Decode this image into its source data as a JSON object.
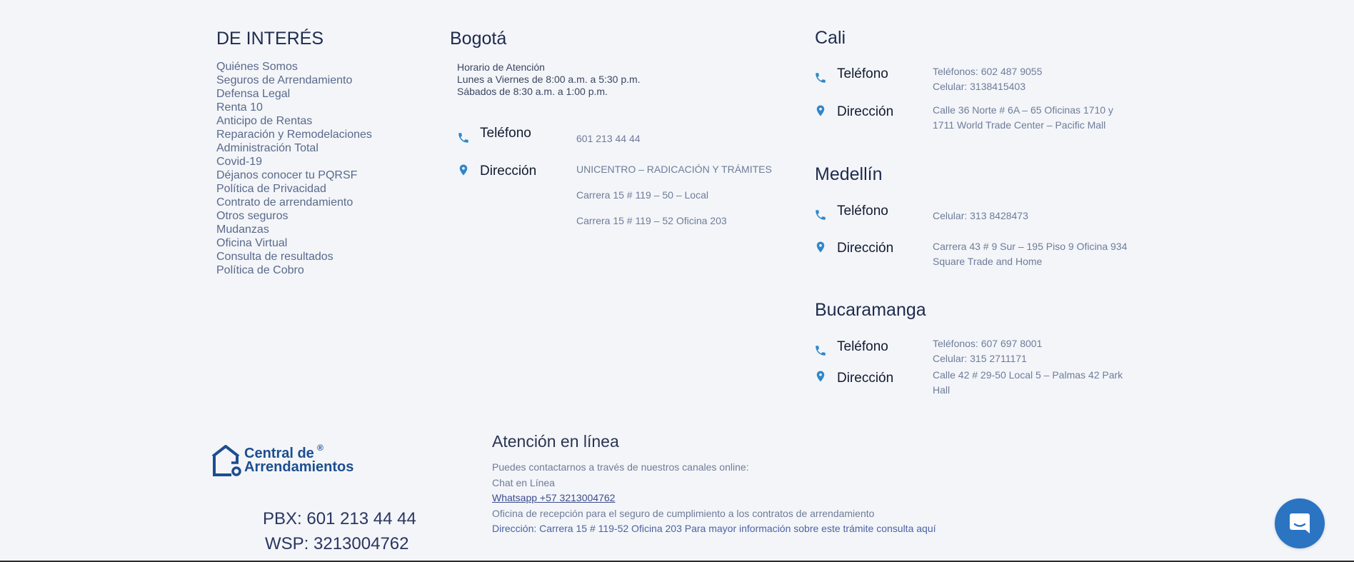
{
  "interes": {
    "title": "DE INTERÉS",
    "links": [
      "Quiénes Somos",
      "Seguros de Arrendamiento",
      "Defensa Legal",
      "Renta 10",
      "Anticipo de Rentas",
      "Reparación y Remodelaciones",
      "Administración Total",
      "Covid-19",
      "Déjanos conocer tu PQRSF",
      "Política de Privacidad",
      "Contrato de arrendamiento",
      "Otros seguros",
      "Mudanzas",
      "Oficina Virtual",
      "Consulta de resultados",
      "Política de Cobro"
    ]
  },
  "bogota": {
    "title": "Bogotá",
    "hours_title": "Horario de Atención",
    "hours_weekday": "Lunes a Viernes de 8:00 a.m. a 5:30 p.m.",
    "hours_saturday": "Sábados de 8:30 a.m. a 1:00 p.m.",
    "phone_label": "Teléfono",
    "phone_value": "601 213 44 44",
    "address_label": "Dirección",
    "address_lines": [
      "UNICENTRO – RADICACIÓN Y TRÁMITES",
      "Carrera 15 # 119 – 50 – Local",
      "Carrera 15 # 119 – 52 Oficina 203"
    ]
  },
  "cali": {
    "title": "Cali",
    "phone_label": "Teléfono",
    "phone_lines": [
      "Teléfonos: 602 487 9055",
      "Celular: 3138415403"
    ],
    "address_label": "Dirección",
    "address_lines": [
      "Calle 36 Norte # 6A – 65 Oficinas 1710 y",
      "1711 World Trade Center – Pacific Mall"
    ]
  },
  "medellin": {
    "title": "Medellín",
    "phone_label": "Teléfono",
    "phone_lines": [
      "Celular: 313 8428473"
    ],
    "address_label": "Dirección",
    "address_lines": [
      "Carrera 43 # 9 Sur – 195 Piso 9 Oficina 934",
      "Square Trade and Home"
    ]
  },
  "bucaramanga": {
    "title": "Bucaramanga",
    "phone_label": "Teléfono",
    "phone_lines": [
      "Teléfonos: 607 697 8001",
      "Celular: 315 2711171"
    ],
    "address_label": "Dirección",
    "address_lines": [
      "Calle 42 # 29-50 Local 5 – Palmas 42 Park",
      "Hall"
    ]
  },
  "brand": {
    "logo_line1": "Central de",
    "logo_line2": "Arrendamientos",
    "registered": "®",
    "pbx": "PBX: 601 213 44 44",
    "wsp": "WSP: 3213004762"
  },
  "online": {
    "title": "Atención en línea",
    "intro": "Puedes contactarnos a través de nuestros canales online:",
    "chat": "Chat en Línea",
    "whatsapp": "Whatsapp +57 3213004762",
    "reception": "Oficina de recepción para el seguro de cumplimiento a los contratos de arrendamiento",
    "address": "Dirección: Carrera 15 # 119-52 Oficina 203 Para mayor información sobre este trámite consulta aquí"
  },
  "colors": {
    "accent": "#2f87c9",
    "brand": "#1d4e8f",
    "chat_button": "#2a74c2",
    "background": "#f3f5f9"
  },
  "icons": {
    "phone": "phone-icon",
    "location": "map-pin-icon",
    "chat": "chat-bubble-icon",
    "logo": "house-key-logo"
  }
}
